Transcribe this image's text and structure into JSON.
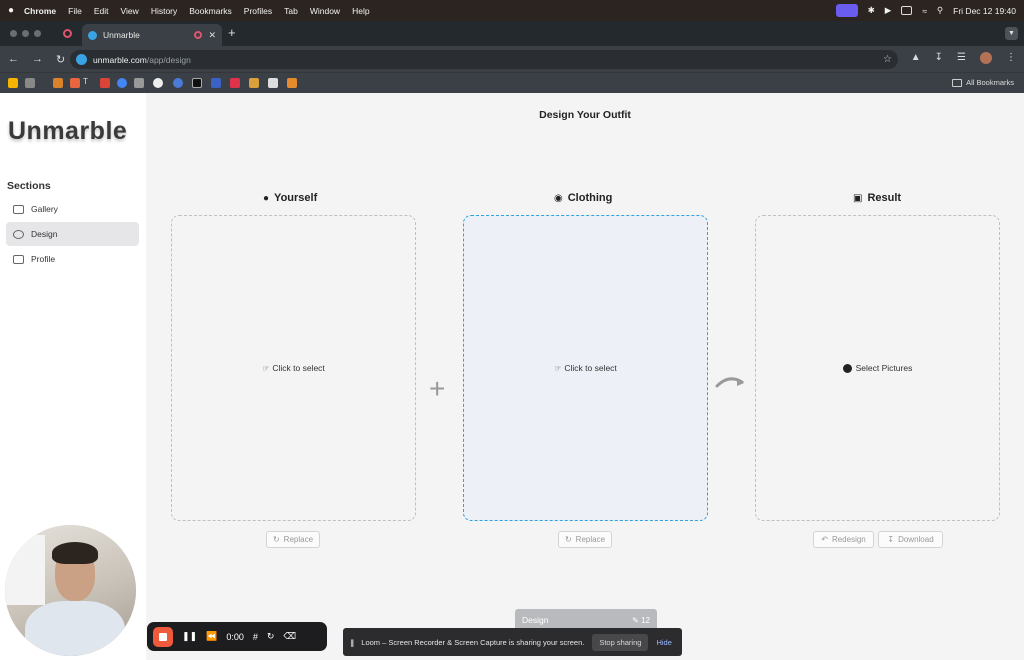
{
  "menubar": {
    "apple": "",
    "app": "Chrome",
    "items": [
      "File",
      "Edit",
      "View",
      "History",
      "Bookmarks",
      "Profiles",
      "Tab",
      "Window",
      "Help"
    ],
    "datetime": "Fri Dec 12  19:40"
  },
  "browser": {
    "tab_title": "Unmarble",
    "url_domain": "unmarble.com",
    "url_path": "/app/design",
    "all_bookmarks": "All Bookmarks",
    "bookmark_letters": {
      "t": "T"
    }
  },
  "sidebar": {
    "logo": "Unmarble",
    "section_title": "Sections",
    "items": [
      {
        "label": "Gallery",
        "active": false
      },
      {
        "label": "Design",
        "active": true
      },
      {
        "label": "Profile",
        "active": false
      }
    ]
  },
  "main": {
    "title": "Design Your Outfit",
    "columns": [
      {
        "title": "Yourself",
        "prompt": "Click to select",
        "icon": "person-icon"
      },
      {
        "title": "Clothing",
        "prompt": "Click to select",
        "icon": "shirt-icon"
      },
      {
        "title": "Result",
        "prompt": "Select Pictures",
        "icon": "camera-icon"
      }
    ],
    "buttons": {
      "replace": "Replace",
      "redesign": "Redesign",
      "download": "Download"
    },
    "highlight_color": "#2ea3e0"
  },
  "design_pill": {
    "label": "Design",
    "count": "12"
  },
  "loom": {
    "time": "0:00",
    "banner": "Loom – Screen Recorder & Screen Capture is sharing your screen.",
    "stop_sharing": "Stop sharing",
    "hide": "Hide"
  }
}
